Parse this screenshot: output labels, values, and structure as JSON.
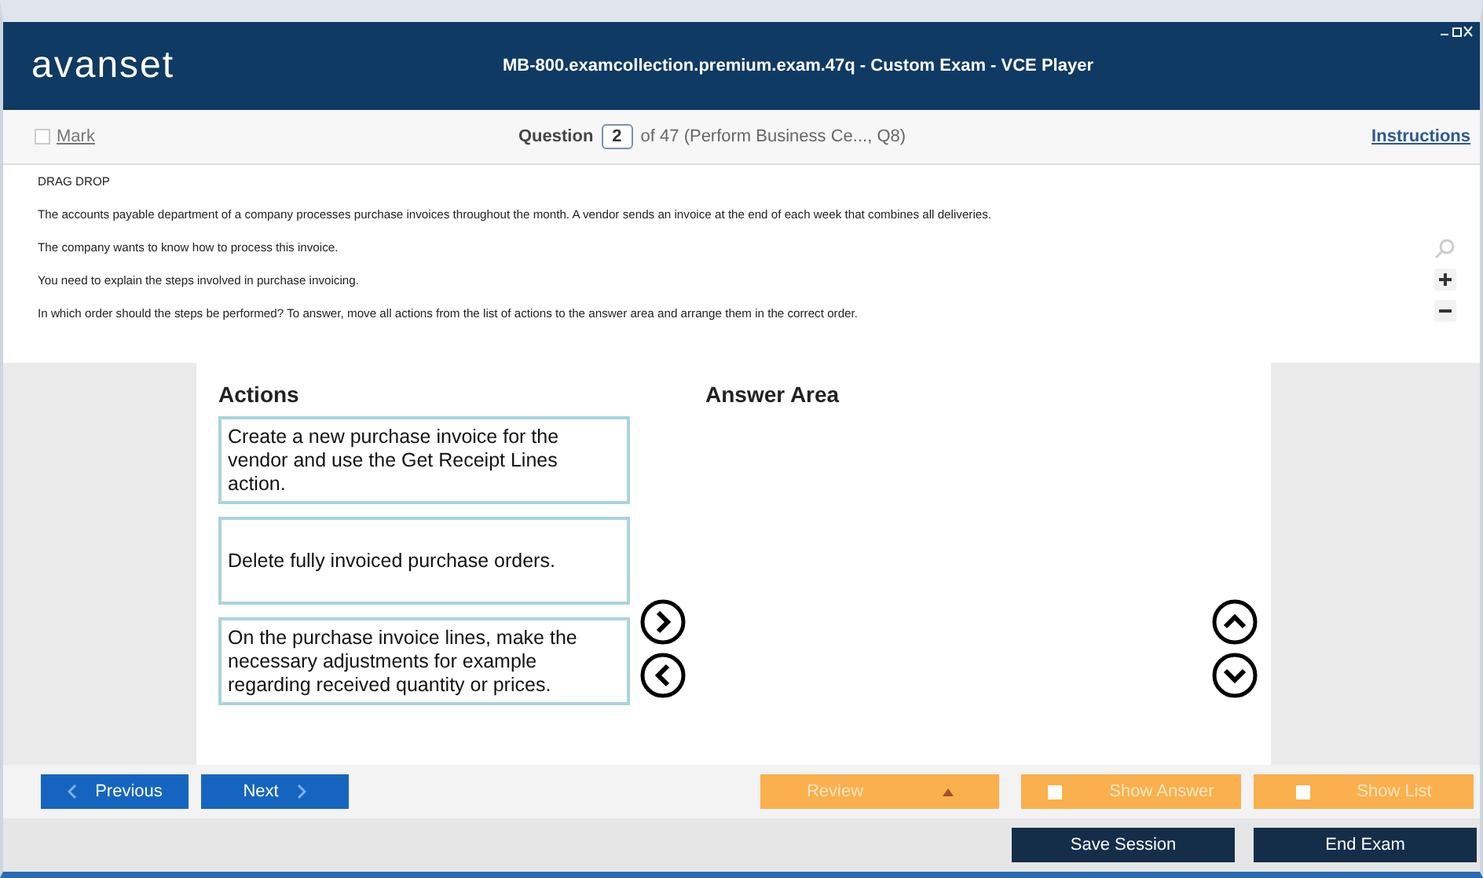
{
  "window": {
    "logo": "avanset",
    "title": "MB-800.examcollection.premium.exam.47q - Custom Exam - VCE Player"
  },
  "header": {
    "mark": {
      "label": "Mark",
      "checked": false
    },
    "question_label": "Question",
    "question_number": "2",
    "question_of": "of 47 (Perform Business Ce..., Q8)",
    "instructions": "Instructions"
  },
  "question": {
    "paragraphs": [
      "DRAG DROP",
      "The accounts payable department of a company processes purchase invoices throughout the month. A vendor sends an invoice at the end of each week that combines all deliveries.",
      "The company wants to know how to process this invoice.",
      "You need to explain the steps involved in purchase invoicing.",
      "In which order should the steps be performed? To answer, move all actions from the list of actions to the answer area and arrange them in the correct order."
    ]
  },
  "drag_drop": {
    "actions_title": "Actions",
    "answer_title": "Answer Area",
    "actions": [
      "Create a new purchase invoice for the vendor and use the Get Receipt Lines action.",
      "Delete fully invoiced purchase orders.",
      "On the purchase invoice lines, make the necessary adjustments for example regarding received quantity or prices."
    ]
  },
  "nav": {
    "previous": "Previous",
    "next": "Next",
    "review": "Review",
    "show_answer": {
      "label": "Show Answer",
      "checked": false
    },
    "show_list": {
      "label": "Show List",
      "checked": false
    },
    "save_session": "Save Session",
    "end_exam": "End Exam"
  }
}
